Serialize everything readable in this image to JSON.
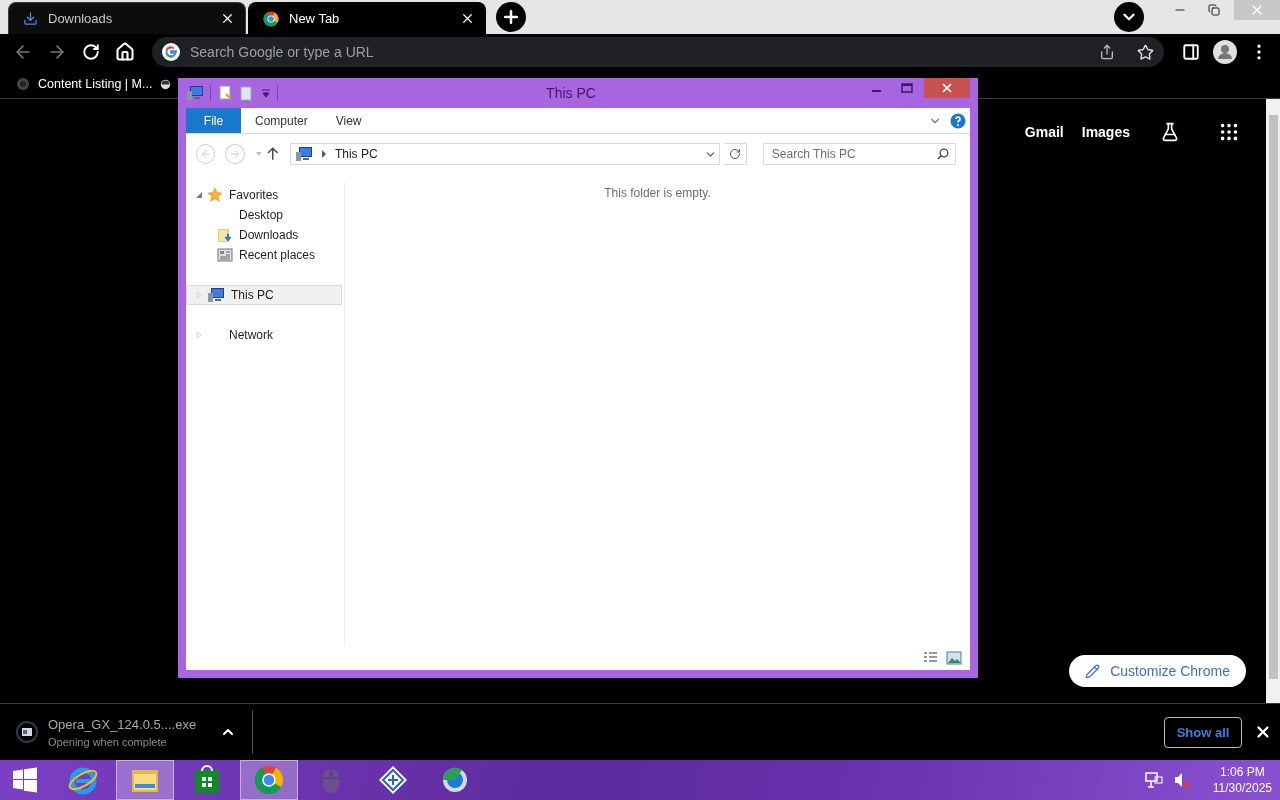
{
  "browser": {
    "tabs": [
      {
        "label": "Downloads",
        "selected": false,
        "kind": "download"
      },
      {
        "label": "New Tab",
        "selected": true,
        "kind": "chrome"
      }
    ],
    "omnibox": {
      "placeholder": "Search Google or type a URL"
    },
    "bookmarks": [
      {
        "label": "Content Listing | M..."
      }
    ],
    "header_links": [
      "Gmail",
      "Images"
    ],
    "customize_button": "Customize Chrome",
    "download": {
      "filename": "Opera_GX_124.0.5....exe",
      "status": "Opening when complete"
    },
    "show_all": "Show all"
  },
  "explorer": {
    "title": "This PC",
    "ribbon_tabs": [
      {
        "label": "File",
        "selected": true
      },
      {
        "label": "Computer",
        "selected": false
      },
      {
        "label": "View",
        "selected": false
      }
    ],
    "address": "This PC",
    "search": {
      "placeholder": "Search This PC"
    },
    "nav": [
      {
        "label": "Favorites",
        "kind": "favorites",
        "expanded": true,
        "selected": false,
        "children": [
          {
            "label": "Desktop",
            "kind": "plain",
            "selected": false
          },
          {
            "label": "Downloads",
            "kind": "downloads",
            "selected": false
          },
          {
            "label": "Recent places",
            "kind": "recent",
            "selected": false
          }
        ]
      },
      {
        "label": "This PC",
        "kind": "pc",
        "expanded": false,
        "selected": true
      },
      {
        "label": "Network",
        "kind": "plain",
        "expanded": false,
        "selected": false
      }
    ],
    "empty_message": "This folder is empty."
  },
  "taskbar": {
    "apps": [
      {
        "kind": "ie",
        "active": false
      },
      {
        "kind": "folder",
        "active": true
      },
      {
        "kind": "store",
        "active": false
      },
      {
        "kind": "chrome",
        "active": true
      },
      {
        "kind": "mouse",
        "active": false
      },
      {
        "kind": "grid",
        "active": false
      },
      {
        "kind": "globe",
        "active": false
      }
    ],
    "time": "1:06 PM",
    "date": "11/30/2025"
  }
}
